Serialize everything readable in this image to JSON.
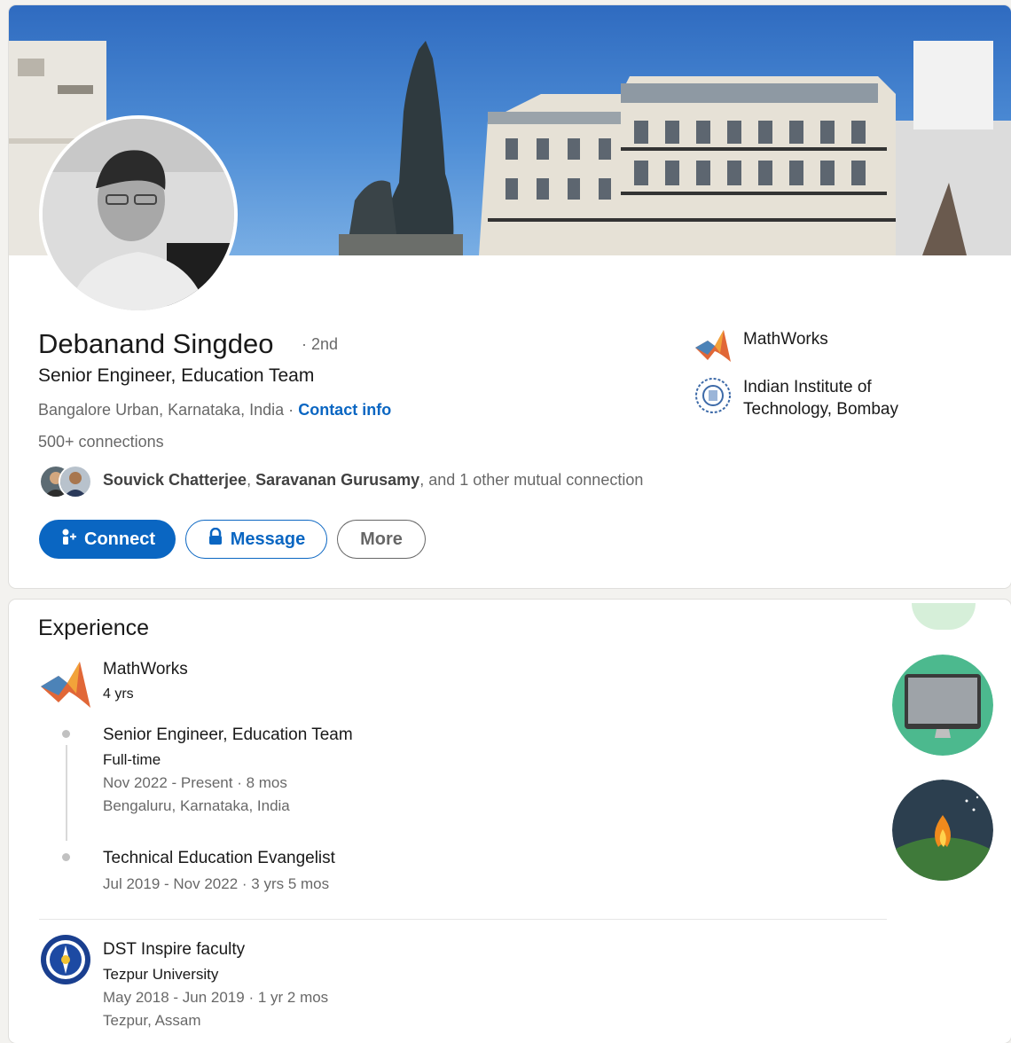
{
  "profile": {
    "name": "Debanand Singdeo",
    "degree": "· 2nd",
    "headline": "Senior Engineer, Education Team",
    "location": "Bangalore Urban, Karnataka, India ·",
    "contact_info": "Contact info",
    "connections": "500+ connections",
    "mutual_name_1": "Souvick Chatterjee",
    "mutual_sep": ",",
    "mutual_name_2": "Saravanan Gurusamy",
    "mutual_rest": ", and 1 other mutual connection"
  },
  "actions": {
    "connect": "Connect",
    "message": "Message",
    "more": "More"
  },
  "orgs": [
    {
      "label": "MathWorks",
      "icon": "matlab-logo-icon"
    },
    {
      "label": "Indian Institute of Technology, Bombay",
      "icon": "iit-bombay-seal-icon"
    }
  ],
  "experience": {
    "title": "Experience",
    "company": "MathWorks",
    "company_duration": "4 yrs",
    "roles": [
      {
        "title": "Senior Engineer, Education Team",
        "type": "Full-time",
        "dates": "Nov 2022 - Present · 8 mos",
        "location": "Bengaluru, Karnataka, India"
      },
      {
        "title": "Technical Education Evangelist",
        "dates": "Jul 2019 - Nov 2022 · 3 yrs 5 mos"
      }
    ],
    "second": {
      "title": "DST Inspire faculty",
      "company": "Tezpur University",
      "dates": "May 2018 - Jun 2019 · 1 yr 2 mos",
      "location": "Tezpur, Assam"
    }
  },
  "colors": {
    "primary": "#0a66c2",
    "page_bg": "#f3f2ef"
  }
}
